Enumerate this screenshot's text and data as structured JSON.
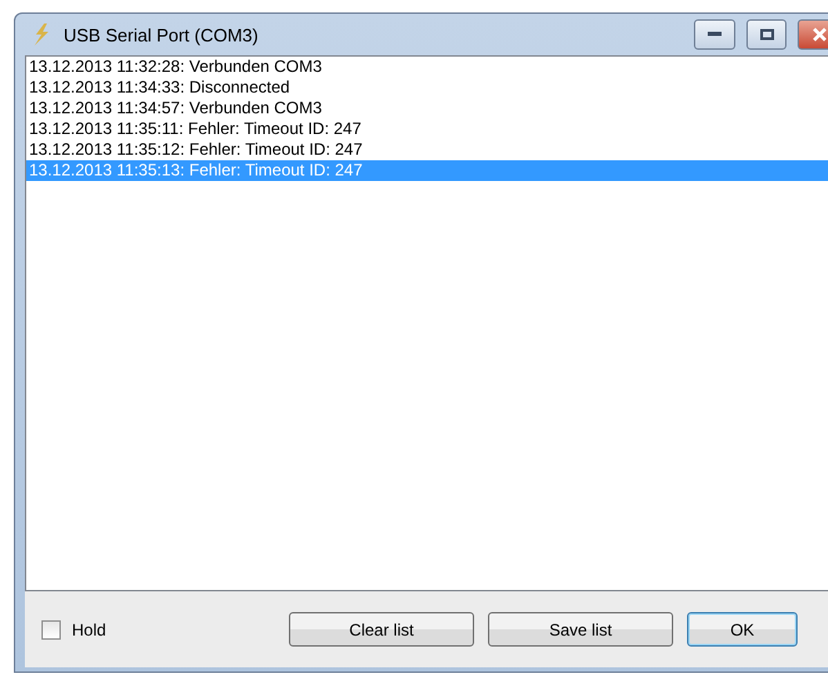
{
  "window": {
    "title": "USB Serial Port (COM3)"
  },
  "log": [
    {
      "text": "13.12.2013 11:32:28: Verbunden COM3",
      "selected": false
    },
    {
      "text": "13.12.2013 11:34:33: Disconnected",
      "selected": false
    },
    {
      "text": "13.12.2013 11:34:57: Verbunden COM3",
      "selected": false
    },
    {
      "text": "13.12.2013 11:35:11: Fehler: Timeout ID: 247",
      "selected": false
    },
    {
      "text": "13.12.2013 11:35:12: Fehler: Timeout ID: 247",
      "selected": false
    },
    {
      "text": "13.12.2013 11:35:13: Fehler: Timeout ID: 247",
      "selected": true
    }
  ],
  "hold": {
    "label": "Hold",
    "checked": false
  },
  "buttons": [
    {
      "label": "Clear list",
      "default": false
    },
    {
      "label": "Save list",
      "default": false
    },
    {
      "label": "OK",
      "default": true
    }
  ]
}
